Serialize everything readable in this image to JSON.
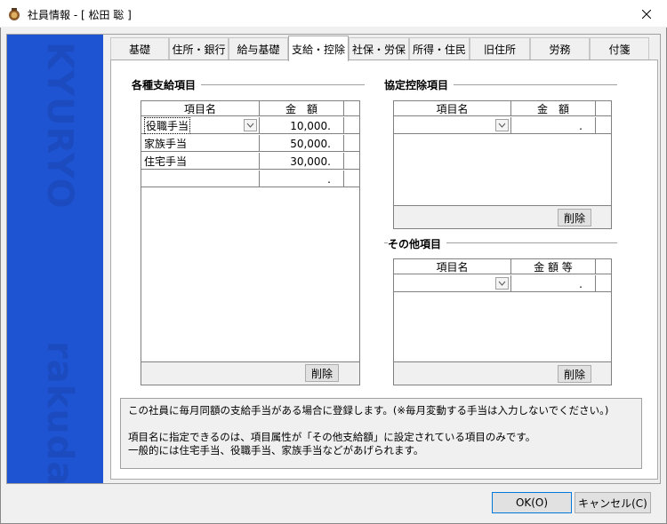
{
  "window": {
    "title": "社員情報 - [ 松田 聡 ]"
  },
  "banner": {
    "top_word": "KYURYO",
    "bottom_word": "rakuda"
  },
  "tabs": [
    {
      "label": "基礎",
      "active": false
    },
    {
      "label": "住所・銀行",
      "active": false
    },
    {
      "label": "給与基礎",
      "active": false
    },
    {
      "label": "支給・控除",
      "active": true
    },
    {
      "label": "社保・労保",
      "active": false
    },
    {
      "label": "所得・住民",
      "active": false
    },
    {
      "label": "旧住所",
      "active": false
    },
    {
      "label": "労務",
      "active": false
    },
    {
      "label": "付箋",
      "active": false
    }
  ],
  "allowances": {
    "title": "各種支給項目",
    "col_name": "項目名",
    "col_amount": "金　額",
    "rows": [
      {
        "name": "役職手当",
        "amount": "10,000."
      },
      {
        "name": "家族手当",
        "amount": "50,000."
      },
      {
        "name": "住宅手当",
        "amount": "30,000."
      },
      {
        "name": "",
        "amount": "."
      }
    ],
    "delete_label": "削除"
  },
  "agreed_deductions": {
    "title": "協定控除項目",
    "col_name": "項目名",
    "col_amount": "金　額",
    "rows": [
      {
        "name": "",
        "amount": "."
      }
    ],
    "delete_label": "削除"
  },
  "other_items": {
    "title": "その他項目",
    "col_name": "項目名",
    "col_amount": "金 額 等",
    "rows": [
      {
        "name": "",
        "amount": "."
      }
    ],
    "delete_label": "削除"
  },
  "info": {
    "line1": "この社員に毎月同額の支給手当がある場合に登録します。(※毎月変動する手当は入力しないでください。)",
    "line2": "項目名に指定できるのは、項目属性が「その他支給額」に設定されている項目のみです。",
    "line3": "一般的には住宅手当、役職手当、家族手当などがあげられます。"
  },
  "buttons": {
    "ok": "OK(O)",
    "cancel": "キャンセル(C)"
  }
}
